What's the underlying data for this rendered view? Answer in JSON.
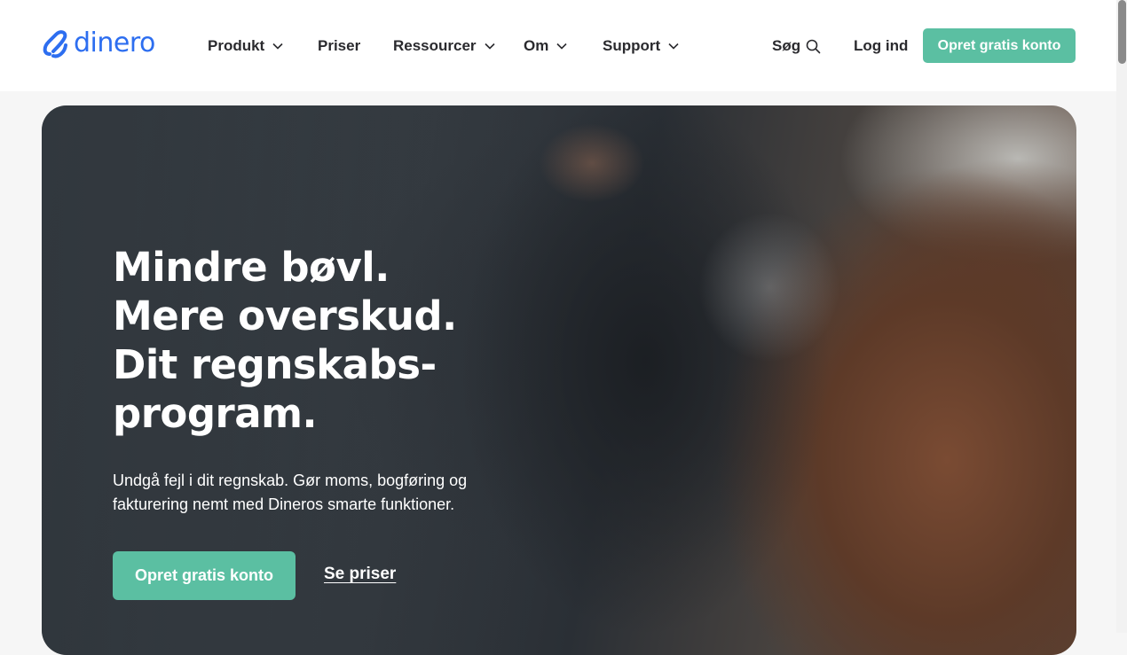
{
  "header": {
    "logo_text": "dinero",
    "nav": [
      {
        "label": "Produkt",
        "has_dropdown": true,
        "icon": "chevron-down-icon"
      },
      {
        "label": "Priser",
        "has_dropdown": false
      },
      {
        "label": "Ressourcer",
        "has_dropdown": true,
        "icon": "chevron-down-icon"
      },
      {
        "label": "Om",
        "has_dropdown": true,
        "icon": "chevron-down-icon"
      },
      {
        "label": "Support",
        "has_dropdown": true,
        "icon": "chevron-down-icon"
      }
    ],
    "search_label": "Søg",
    "search_icon": "search-icon",
    "login_label": "Log ind",
    "cta_label": "Opret gratis konto"
  },
  "hero": {
    "title_lines": [
      "Mindre bøvl.",
      "Mere overskud.",
      "Dit regnskabs-",
      "program."
    ],
    "subtitle_lines": [
      "Undgå fejl i dit regnskab. Gør moms, bogføring og",
      "fakturering nemt med Dineros smarte funktioner."
    ],
    "primary_cta": "Opret gratis konto",
    "secondary_link": "Se priser"
  },
  "colors": {
    "brand_blue": "#2d6ef0",
    "accent_green": "#5bbfa2",
    "text_dark": "#2a2a2e"
  }
}
